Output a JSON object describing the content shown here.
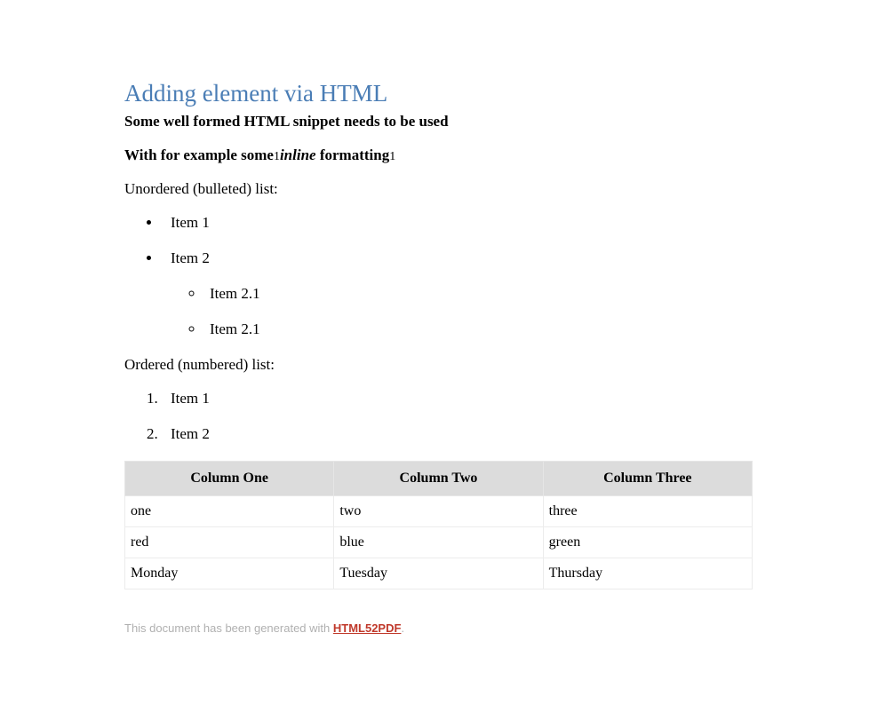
{
  "heading": "Adding element via HTML",
  "subheading": "Some well formed HTML snippet needs to be used",
  "para_segments": {
    "s1": "With for example ",
    "s2": "some",
    "s3": "1",
    "s4": "inline",
    "s5": " formatting",
    "s6": "1"
  },
  "unordered_label": "Unordered (bulleted) list:",
  "unordered_items": {
    "i1": "Item 1",
    "i2": "Item 2",
    "i2_1": "Item 2.1",
    "i2_2": "Item 2.1"
  },
  "ordered_label": "Ordered (numbered) list:",
  "ordered_items": {
    "i1": "Item 1",
    "i2": "Item 2"
  },
  "table": {
    "headers": {
      "c1": "Column One",
      "c2": "Column Two",
      "c3": "Column Three"
    },
    "rows": [
      {
        "c1": "one",
        "c2": "two",
        "c3": "three"
      },
      {
        "c1": "red",
        "c2": "blue",
        "c3": "green"
      },
      {
        "c1": "Monday",
        "c2": "Tuesday",
        "c3": "Thursday"
      }
    ]
  },
  "footer": {
    "prefix": "This document has been generated with ",
    "link": "HTML52PDF",
    "suffix": "."
  }
}
